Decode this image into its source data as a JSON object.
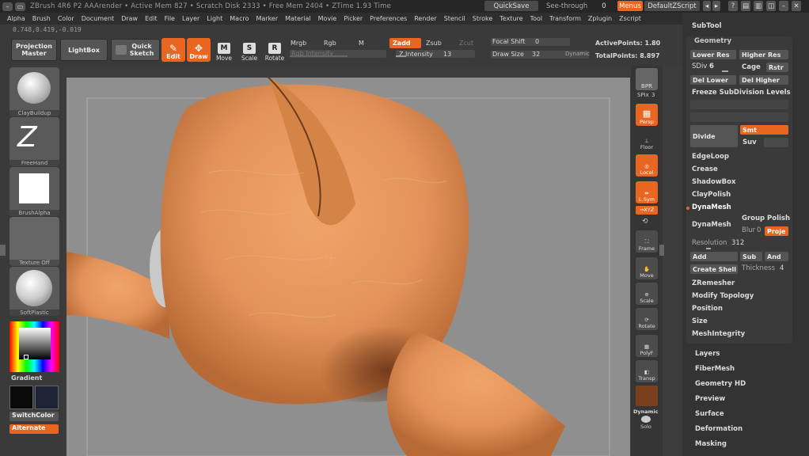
{
  "titlebar": {
    "title": "ZBrush 4R6 P2   AAArender   • Active Mem 827 • Scratch Disk 2333 • Free Mem 2404 • ZTime 1.93 Time",
    "quicksave": "QuickSave",
    "seethrough": "See-through",
    "seethrough_value": "0",
    "menus": "Menus",
    "zscript": "DefaultZScript"
  },
  "menubar": [
    "Alpha",
    "Brush",
    "Color",
    "Document",
    "Draw",
    "Edit",
    "File",
    "Layer",
    "Light",
    "Macro",
    "Marker",
    "Material",
    "Movie",
    "Picker",
    "Preferences",
    "Render",
    "Stencil",
    "Stroke",
    "Texture",
    "Tool",
    "Transform",
    "Zplugin",
    "Zscript"
  ],
  "coords": "0.748,0.419,-0.019",
  "shelf": {
    "projection_master": "Projection Master",
    "lightbox": "LightBox",
    "quick_sketch": "Quick Sketch",
    "edit": "Edit",
    "draw": "Draw",
    "move": "Move",
    "scale": "Scale",
    "rotate": "Rotate",
    "mrgb": "Mrgb",
    "rgb": "Rgb",
    "m": "M",
    "rgb_intensity": "Rgb Intensity",
    "zadd": "Zadd",
    "zsub": "Zsub",
    "zcut": "Zcut",
    "z_intensity": "Z Intensity",
    "z_intensity_value": "13",
    "focal_shift": "Focal Shift",
    "focal_shift_value": "0",
    "draw_size": "Draw Size",
    "draw_size_value": "32",
    "dynamic": "Dynamic",
    "active_points": "ActivePoints: 1.80",
    "total_points": "TotalPoints: 8.897"
  },
  "lefttray": {
    "brush": "ClayBuildup",
    "stroke": "FreeHand",
    "alpha": "BrushAlpha",
    "texture": "Texture Off",
    "material": "SoftPlastic",
    "gradient": "Gradient",
    "switchcolor": "SwitchColor",
    "alternate": "Alternate"
  },
  "rightstrip": {
    "bpr": "BPR",
    "spix": "SPix",
    "spix_value": "3",
    "persp": "Persp",
    "floor": "Floor",
    "local": "Local",
    "lsym": "L.Sym",
    "xyz": "→XYZ",
    "frame": "Frame",
    "move": "Move",
    "scale": "Scale",
    "rotate": "Rotate",
    "polyf": "PolyF",
    "transp": "Transp",
    "dynamic": "Dynamic",
    "solo": "Solo"
  },
  "panel": {
    "subtool": "SubTool",
    "geometry": "Geometry",
    "lower_res": "Lower Res",
    "higher_res": "Higher Res",
    "sdiv": "SDiv",
    "sdiv_value": "6",
    "cage": "Cage",
    "rstr": "Rstr",
    "del_lower": "Del Lower",
    "del_higher": "Del Higher",
    "freeze": "Freeze SubDivision Levels",
    "divide": "Divide",
    "smt": "Smt",
    "suv": "Suv",
    "edgeloop": "EdgeLoop",
    "crease": "Crease",
    "shadowbox": "ShadowBox",
    "claypolish": "ClayPolish",
    "dynamesh_header": "DynaMesh",
    "dynamesh_btn": "DynaMesh",
    "group": "Group",
    "polish": "Polish",
    "blur": "Blur",
    "blur_value": "0",
    "proje": "Proje",
    "resolution": "Resolution",
    "resolution_value": "312",
    "add": "Add",
    "sub": "Sub",
    "and": "And",
    "create_shell": "Create Shell",
    "thickness": "Thickness",
    "thickness_value": "4",
    "zremesher": "ZRemesher",
    "modify_topology": "Modify Topology",
    "position": "Position",
    "size": "Size",
    "meshintegrity": "MeshIntegrity",
    "layers": "Layers",
    "fibermesh": "FiberMesh",
    "geometry_hd": "Geometry HD",
    "preview": "Preview",
    "surface": "Surface",
    "deformation": "Deformation",
    "masking": "Masking"
  },
  "colors": {
    "accent": "#e8661f",
    "clay": "#e3935a",
    "background": "#8f8f8f"
  }
}
